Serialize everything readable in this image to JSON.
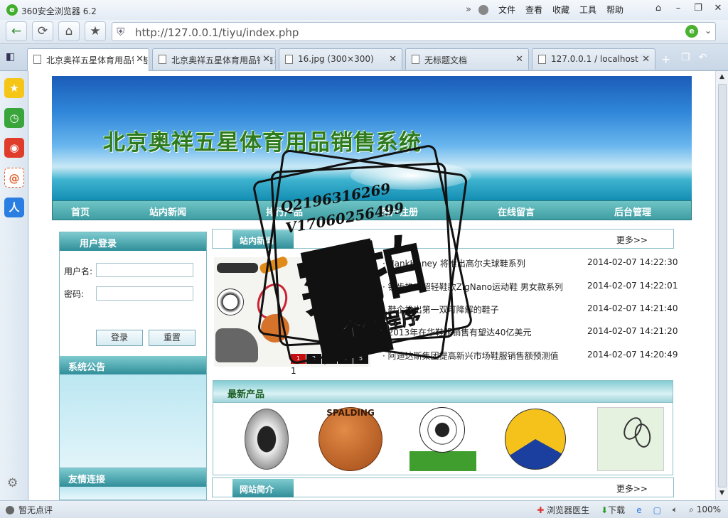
{
  "browser": {
    "app_title": "360安全浏览器 6.2",
    "menu": [
      "文件",
      "查看",
      "收藏",
      "工具",
      "帮助"
    ],
    "url": "http://127.0.0.1/tiyu/index.php",
    "tabs": [
      {
        "label": "北京奥祥五星体育用品销售系统",
        "active": true
      },
      {
        "label": "北京奥祥五星体育用品销售系统",
        "active": false
      },
      {
        "label": "16.jpg (300×300)",
        "active": false
      },
      {
        "label": "无标题文档",
        "active": false
      },
      {
        "label": "127.0.0.1 / localhost",
        "active": false
      }
    ],
    "status_left": "暂无点评",
    "status_right": [
      "浏览器医生",
      "下载",
      "100%"
    ]
  },
  "site": {
    "title": "北京奥祥五星体育用品销售系统",
    "nav": [
      "首页",
      "站内新闻",
      "排行产品",
      "用户注册",
      "在线留言",
      "后台管理"
    ],
    "login": {
      "heading": "用户登录",
      "username_label": "用户名:",
      "password_label": "密码:",
      "login_button": "登录",
      "reset_button": "重置"
    },
    "notice_heading": "系统公告",
    "links_heading": "友情连接",
    "news": {
      "heading": "站内新闻",
      "more": "更多>>",
      "slider_numbers": [
        "1",
        "2",
        "3",
        "4",
        "5"
      ],
      "slider_caption": "1",
      "items": [
        {
          "title": "· HankHaney 将推出高尔夫球鞋系列",
          "date": "2014-02-07 14:22:30"
        },
        {
          "title": "· 锐步推出超轻鞋款ZigNano运动鞋 男女款系列",
          "date": "2014-02-07 14:22:01"
        },
        {
          "title": "· 鞋企推出第一双可降解的鞋子",
          "date": "2014-02-07 14:21:40"
        },
        {
          "title": "· 2013年在华鞋服销售有望达40亿美元",
          "date": "2014-02-07 14:21:20"
        },
        {
          "title": "· 阿迪达斯集团提高新兴市场鞋服销售额预测值",
          "date": "2014-02-07 14:20:49"
        }
      ]
    },
    "products": {
      "heading": "最新产品",
      "items": [
        "black-white-ball",
        "spalding-basketball",
        "soccer-ball",
        "volleyball",
        "badminton-rackets"
      ],
      "basketball_text": "SPALDING"
    },
    "intro": {
      "heading": "网站简介",
      "more": "更多>>"
    }
  },
  "watermark": {
    "qq": "Q2196316269",
    "vx": "V17060256499",
    "big": "实拍",
    "sub": "全微程序"
  },
  "colors": {
    "nav_teal": "#3f9ea3",
    "title_green": "#2d7a1f",
    "active_slide": "#c21010"
  }
}
